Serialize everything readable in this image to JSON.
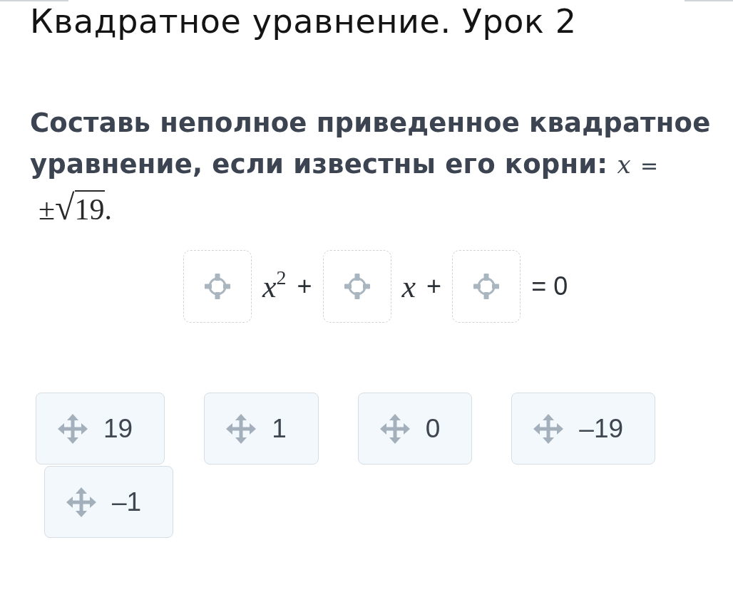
{
  "title": "Квадратное уравнение. Урок 2",
  "question": {
    "text": "Составь неполное приведенное квадратное уравнение, если известны его корни:",
    "formula": {
      "variable": "x",
      "relation": "=",
      "sign": "±",
      "radical": "√",
      "radicand": "19",
      "end": "."
    }
  },
  "equation": [
    {
      "kind": "slot"
    },
    {
      "kind": "term",
      "text": "*x*$^{2}$"
    },
    {
      "kind": "operator",
      "text": "+"
    },
    {
      "kind": "slot"
    },
    {
      "kind": "term",
      "text": "*x*"
    },
    {
      "kind": "operator",
      "text": "+"
    },
    {
      "kind": "slot"
    },
    {
      "kind": "operator",
      "text": "= 0"
    }
  ],
  "options": [
    {
      "label": "19"
    },
    {
      "label": "1"
    },
    {
      "label": "0"
    },
    {
      "label": "–19"
    },
    {
      "label": "–1"
    }
  ]
}
